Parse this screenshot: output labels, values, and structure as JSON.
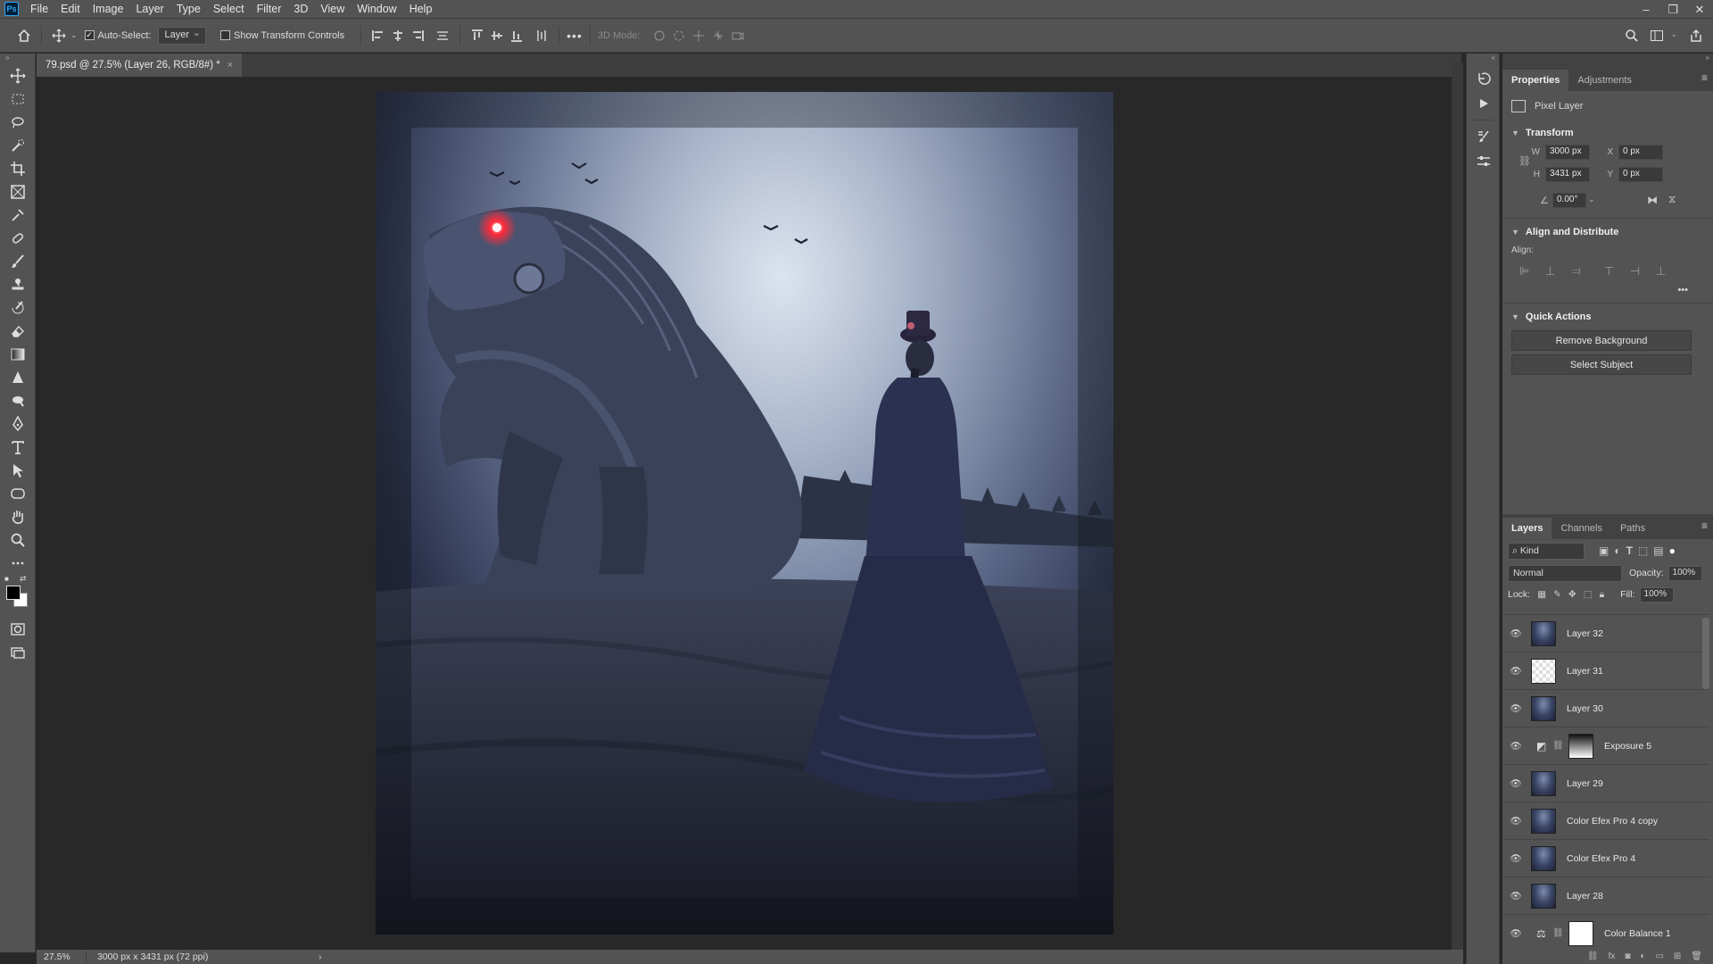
{
  "app": {
    "logo": "Ps"
  },
  "menu": [
    "File",
    "Edit",
    "Image",
    "Layer",
    "Type",
    "Select",
    "Filter",
    "3D",
    "View",
    "Window",
    "Help"
  ],
  "window_controls": {
    "minimize": "–",
    "restore": "❐",
    "close": "✕"
  },
  "options_bar": {
    "auto_select_label": "Auto-Select:",
    "auto_select_checked": true,
    "auto_select_target": "Layer",
    "show_transform_label": "Show Transform Controls",
    "more": "•••",
    "mode_3d_label": "3D Mode:"
  },
  "document": {
    "tab_title": "79.psd @ 27.5% (Layer 26, RGB/8#) *",
    "close": "×"
  },
  "status": {
    "zoom": "27.5%",
    "doc_info": "3000 px x 3431 px (72 ppi)",
    "arrow": "›"
  },
  "properties_panel": {
    "tabs": [
      "Properties",
      "Adjustments"
    ],
    "layer_kind": "Pixel Layer",
    "transform": {
      "title": "Transform",
      "w_label": "W",
      "w": "3000 px",
      "h_label": "H",
      "h": "3431 px",
      "x_label": "X",
      "x": "0 px",
      "y_label": "Y",
      "y": "0 px",
      "angle": "0.00°"
    },
    "align": {
      "title": "Align and Distribute",
      "label": "Align:",
      "more": "•••"
    },
    "quick_actions": {
      "title": "Quick Actions",
      "remove_bg": "Remove Background",
      "select_subject": "Select Subject"
    }
  },
  "layers_panel": {
    "tabs": [
      "Layers",
      "Channels",
      "Paths"
    ],
    "filter_kind": "Kind",
    "blend_mode": "Normal",
    "opacity_label": "Opacity:",
    "opacity": "100%",
    "lock_label": "Lock:",
    "fill_label": "Fill:",
    "fill": "100%",
    "layers": [
      {
        "name": "Layer 32",
        "thumb": "image"
      },
      {
        "name": "Layer 31",
        "thumb": "transparent"
      },
      {
        "name": "Layer 30",
        "thumb": "image"
      },
      {
        "name": "Exposure 5",
        "thumb": "mask",
        "adjustment": "exposure-icon"
      },
      {
        "name": "Layer 29",
        "thumb": "image"
      },
      {
        "name": "Color Efex Pro 4 copy",
        "thumb": "image"
      },
      {
        "name": "Color Efex Pro 4",
        "thumb": "image"
      },
      {
        "name": "Layer 28",
        "thumb": "image"
      },
      {
        "name": "Color Balance 1",
        "thumb": "white",
        "adjustment": "balance-icon"
      }
    ]
  },
  "colors": {
    "ui_bg": "#535353",
    "canvas_bg": "#282828",
    "accent": "#31a8ff",
    "eye_glow": "#ff2a3a"
  }
}
